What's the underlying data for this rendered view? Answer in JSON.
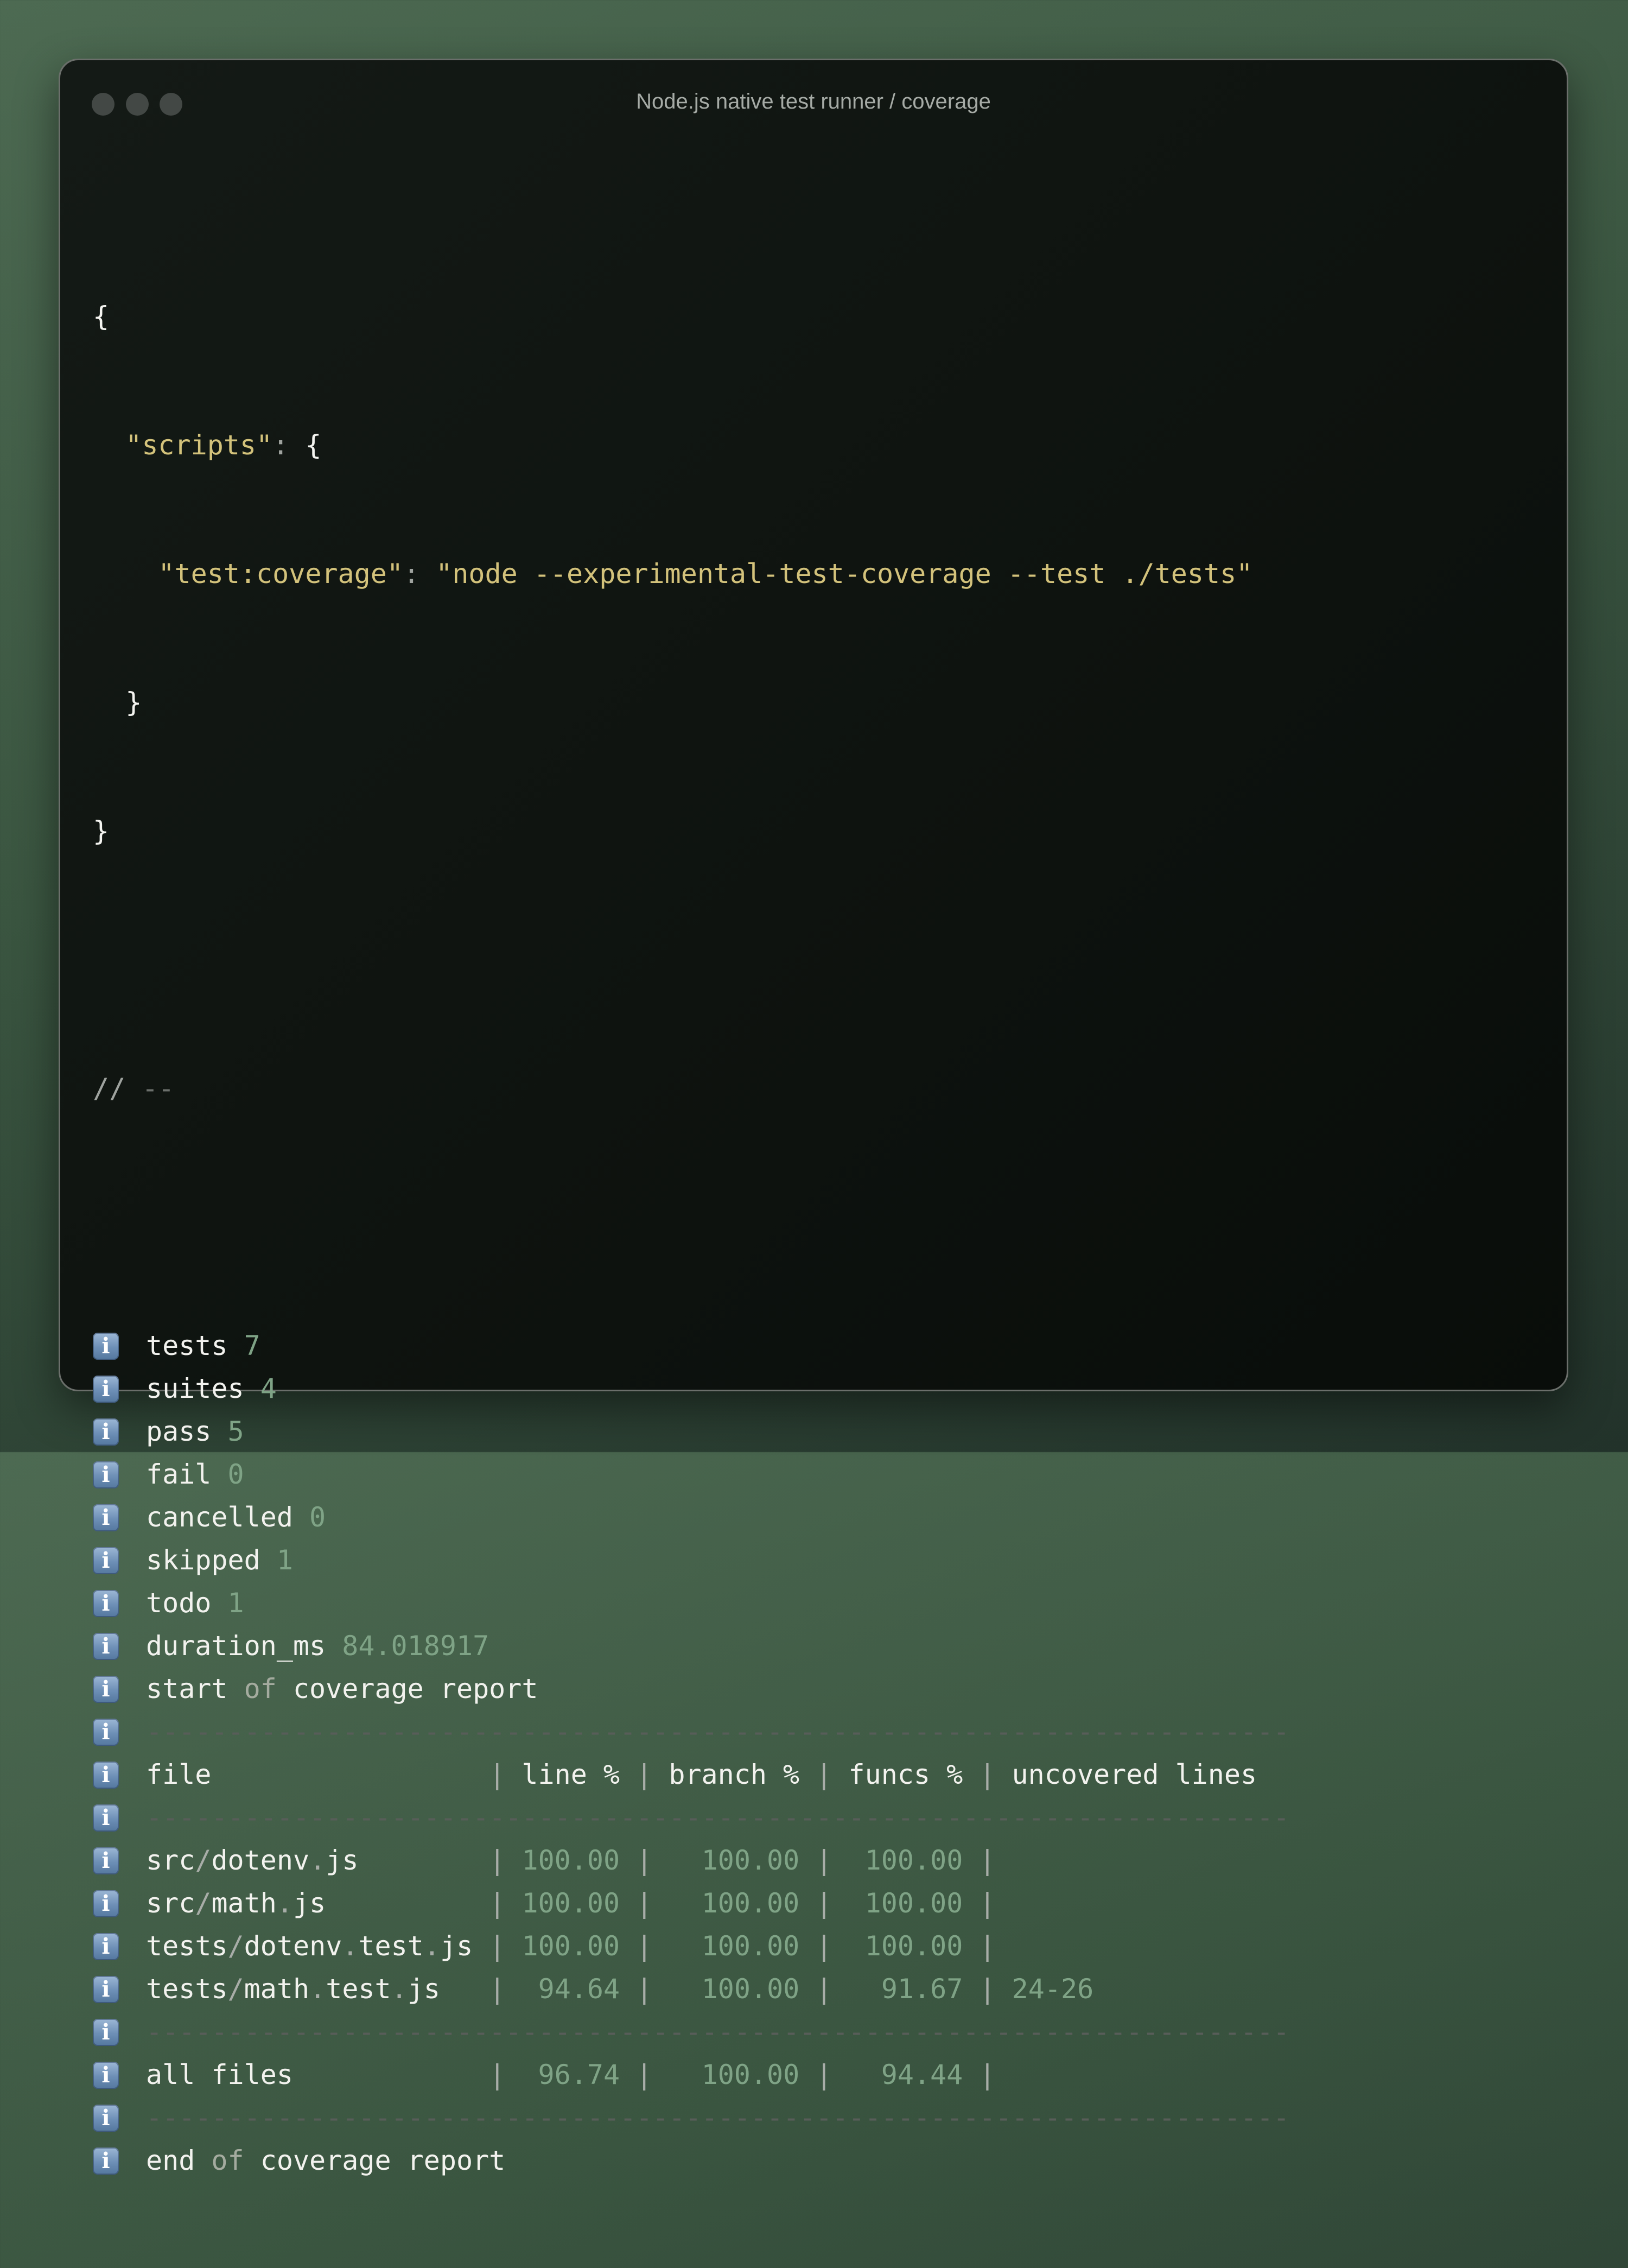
{
  "window": {
    "title": "Node.js native test runner / coverage",
    "controls": [
      "close",
      "minimize",
      "maximize"
    ]
  },
  "package_json": {
    "open_brace": "{",
    "scripts_key": "\"scripts\"",
    "test_coverage_key": "\"test:coverage\"",
    "test_coverage_value": "\"node --experimental-test-coverage --test ./tests\"",
    "close_inner": "}",
    "close_outer": "}"
  },
  "comment": {
    "slashes": "//",
    "dashes": "--"
  },
  "info_icon": "info-icon",
  "summary": [
    {
      "key": "tests",
      "value": "7"
    },
    {
      "key": "suites",
      "value": "4"
    },
    {
      "key": "pass",
      "value": "5"
    },
    {
      "key": "fail",
      "value": "0"
    },
    {
      "key": "cancelled",
      "value": "0"
    },
    {
      "key": "skipped",
      "value": "1"
    },
    {
      "key": "todo",
      "value": "1"
    },
    {
      "key": "duration_ms",
      "value": "84.018917"
    }
  ],
  "report": {
    "start": {
      "a": "start",
      "of": "of",
      "b": "coverage report"
    },
    "end": {
      "a": "end",
      "of": "of",
      "b": "coverage report"
    },
    "divider": "----------------------------------------------------------------------",
    "headers": {
      "file": "file",
      "line": "line %",
      "branch": "branch %",
      "funcs": "funcs %",
      "uncovered": "uncovered lines"
    },
    "rows": [
      {
        "file": "src/dotenv.js",
        "line": "100.00",
        "branch": "100.00",
        "funcs": "100.00",
        "uncovered": ""
      },
      {
        "file": "src/math.js",
        "line": "100.00",
        "branch": "100.00",
        "funcs": "100.00",
        "uncovered": ""
      },
      {
        "file": "tests/dotenv.test.js",
        "line": "100.00",
        "branch": "100.00",
        "funcs": "100.00",
        "uncovered": ""
      },
      {
        "file": "tests/math.test.js",
        "line": "94.64",
        "branch": "100.00",
        "funcs": "91.67",
        "uncovered": "24-26"
      }
    ],
    "total": {
      "file": "all files",
      "line": "96.74",
      "branch": "100.00",
      "funcs": "94.44",
      "uncovered": ""
    }
  },
  "colors": {
    "string": "#d3c27b",
    "number": "#7fa386",
    "muted": "#a8ada8",
    "dash": "#585d59",
    "text": "#f2f2ee"
  }
}
